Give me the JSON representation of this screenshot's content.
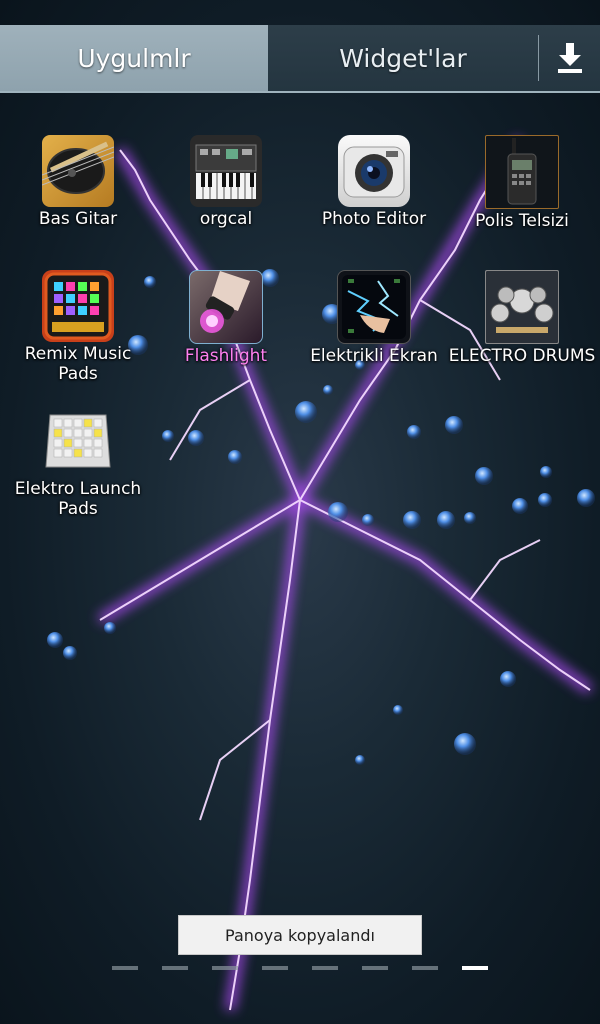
{
  "tabs": {
    "apps_label": "Uygulmlr",
    "widgets_label": "Widget'lar",
    "download_icon": "download-icon"
  },
  "apps": [
    {
      "label": "Bas Gitar",
      "icon": "bass-guitar-icon"
    },
    {
      "label": "orgcal",
      "icon": "keyboard-synth-icon"
    },
    {
      "label": "Photo Editor",
      "icon": "camera-icon"
    },
    {
      "label": "Polis Telsizi",
      "icon": "walkie-talkie-icon"
    },
    {
      "label": "Remix Music Pads",
      "icon": "music-pads-icon"
    },
    {
      "label": "Flashlight",
      "icon": "flashlight-icon"
    },
    {
      "label": "Elektrikli Ekran",
      "icon": "electric-screen-icon"
    },
    {
      "label": "ELECTRO DRUMS",
      "icon": "drum-kit-icon"
    },
    {
      "label": "Elektro Launch Pads",
      "icon": "launch-pad-icon"
    }
  ],
  "toast": {
    "text": "Panoya kopyalandı"
  },
  "pager": {
    "page_count": 8,
    "active_index": 7
  },
  "colors": {
    "tab_active": "#9fb1bb",
    "tab_bar": "#2d3e49",
    "lightning": "#c060ff",
    "orb": "#5aa0ff"
  }
}
